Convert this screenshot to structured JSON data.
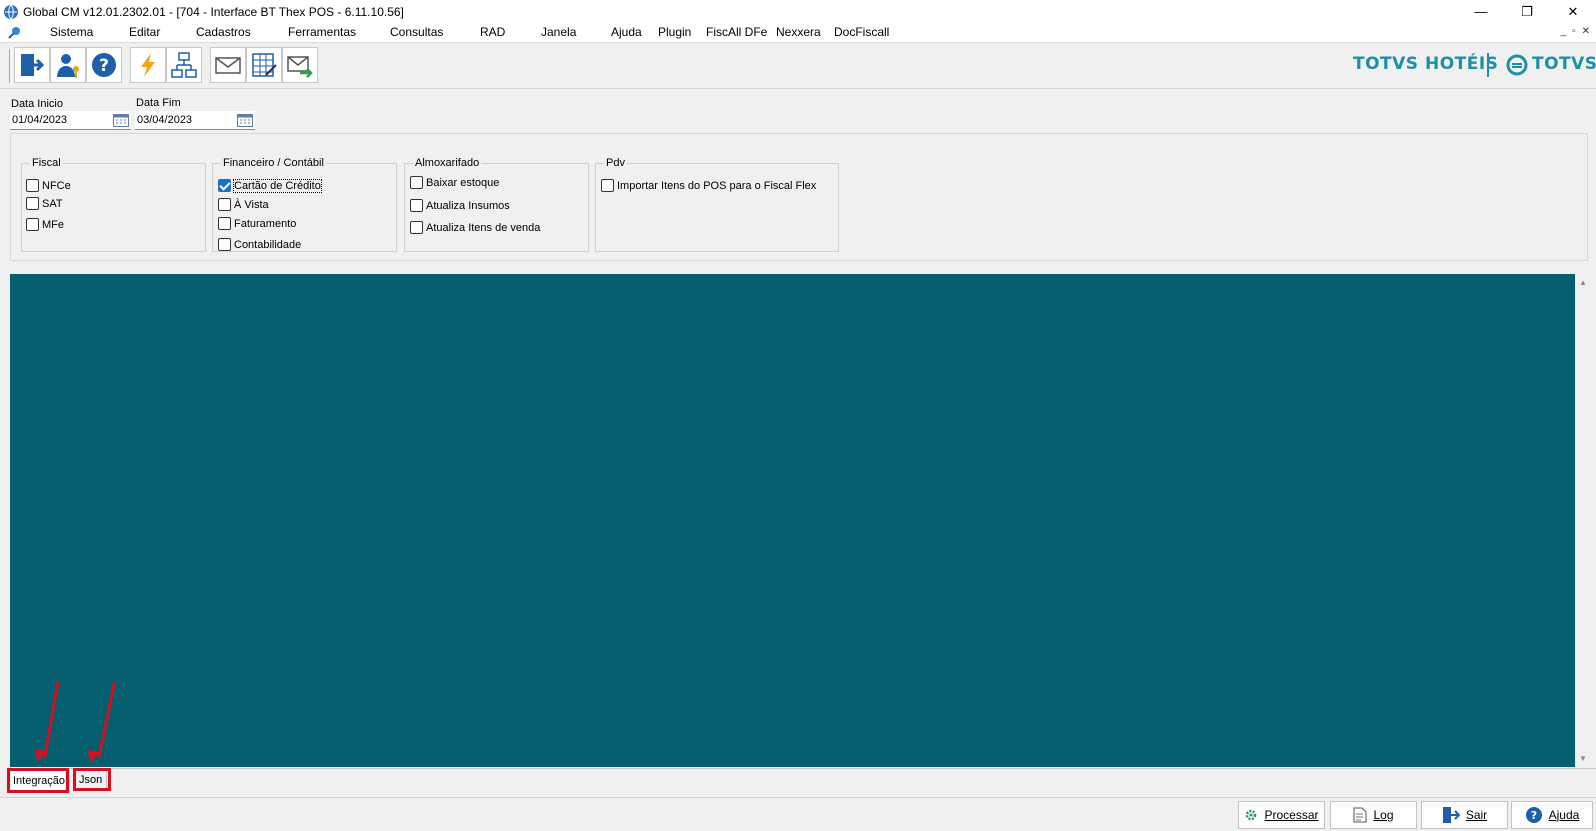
{
  "window": {
    "title": "Global CM v12.01.2302.01 - [704 - Interface BT Thex POS - 6.11.10.56]"
  },
  "menu": {
    "items": [
      "Sistema",
      "Editar",
      "Cadastros",
      "Ferramentas",
      "Consultas",
      "RAD",
      "Janela",
      "Ajuda",
      "Plugin",
      "FiscAll DFe",
      "Nexxera",
      "DocFiscall"
    ]
  },
  "toolbar": {
    "buttons": [
      "exit-icon",
      "user-key-icon",
      "help-icon",
      "lightning-icon",
      "network-icon",
      "mail-icon",
      "spreadsheet-icon",
      "mail-forward-icon"
    ]
  },
  "brand": {
    "hotel": "TOTVS HOTÉIS",
    "totvs": "TOTVS",
    "color": "#1f8fa3"
  },
  "dates": {
    "start_label": "Data Inicio",
    "start_value": "01/04/2023",
    "end_label": "Data Fim",
    "end_value": "03/04/2023"
  },
  "groups": {
    "fiscal": {
      "title": "Fiscal",
      "options": [
        {
          "label": "NFCe",
          "checked": false
        },
        {
          "label": "SAT",
          "checked": false
        },
        {
          "label": "MFe",
          "checked": false
        }
      ]
    },
    "financeiro": {
      "title": "Financeiro / Contábil",
      "options": [
        {
          "label": "Cartão de Crédito",
          "checked": true
        },
        {
          "label": "À Vista",
          "checked": false
        },
        {
          "label": "Faturamento",
          "checked": false
        },
        {
          "label": "Contabilidade",
          "checked": false
        }
      ]
    },
    "almoxarifado": {
      "title": "Almoxarifado",
      "options": [
        {
          "label": "Baixar estoque",
          "checked": false
        },
        {
          "label": "Atualiza Insumos",
          "checked": false
        },
        {
          "label": "Atualiza Itens de venda",
          "checked": false
        }
      ]
    },
    "pdv": {
      "title": "Pdv",
      "options": [
        {
          "label": "Importar Itens do POS para o Fiscal Flex",
          "checked": false
        }
      ]
    }
  },
  "main": {
    "background": "#065f6e"
  },
  "tabs": [
    {
      "label": "Integração",
      "active": true
    },
    {
      "label": "Json",
      "active": false
    }
  ],
  "annotation": {
    "color": "#d40f1f"
  },
  "actions": {
    "processar": "Processar",
    "log": "Log",
    "sair": "Sair",
    "ajuda": "Ajuda"
  }
}
